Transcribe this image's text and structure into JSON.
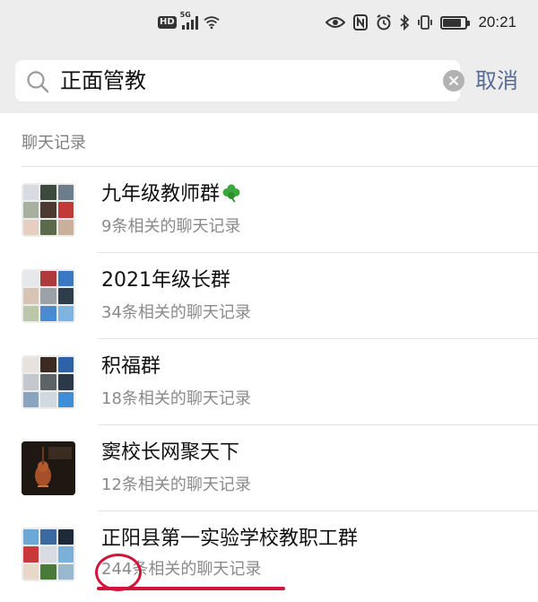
{
  "status_bar": {
    "hd": "HD",
    "net": "5G",
    "time": "20:21",
    "battery_level": 0.8,
    "icons": [
      "eye-icon",
      "nfc-icon",
      "alarm-icon",
      "bluetooth-icon",
      "vibrate-icon"
    ]
  },
  "search": {
    "query": "正面管教",
    "cancel_label": "取消"
  },
  "section": {
    "label": "聊天记录"
  },
  "results": [
    {
      "title": "九年级教师群",
      "subtitle": "9条相关的聊天记录",
      "emoji": "clover-icon"
    },
    {
      "title": "2021年级长群",
      "subtitle": "34条相关的聊天记录"
    },
    {
      "title": "积福群",
      "subtitle": "18条相关的聊天记录"
    },
    {
      "title": "窦校长网聚天下",
      "subtitle": "12条相关的聊天记录"
    },
    {
      "title": "正阳县第一实验学校教职工群",
      "subtitle": "244条相关的聊天记录"
    }
  ],
  "colors": {
    "accent_link": "#576b95",
    "annotation": "#d2143a",
    "clover": "#3aa83a"
  }
}
